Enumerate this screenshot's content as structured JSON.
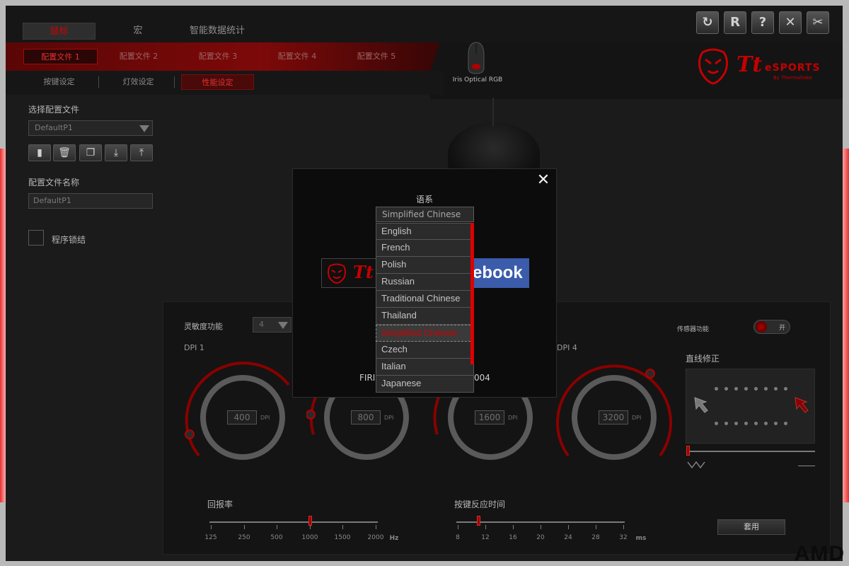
{
  "main_tabs": [
    "鼠标",
    "宏",
    "智能数据统计"
  ],
  "profile_tabs": [
    "配置文件 1",
    "配置文件 2",
    "配置文件 3",
    "配置文件 4",
    "配置文件 5"
  ],
  "sub_tabs": [
    "按键设定",
    "灯效设定",
    "性能设定"
  ],
  "mouse_caption": "Iris Optical RGB",
  "window_buttons": [
    "refresh",
    "reset",
    "help",
    "close",
    "tools"
  ],
  "window_button_glyphs": {
    "refresh": "↻",
    "reset": "R",
    "help": "?",
    "close": "✕",
    "tools": "✂"
  },
  "logo": {
    "tt": "Tt",
    "esports": "eSPORTS",
    "by": "By Thermaltake"
  },
  "left_panel": {
    "select_profile_label": "选择配置文件",
    "select_profile_value": "DefaultP1",
    "profile_name_label": "配置文件名称",
    "profile_name_value": "DefaultP1",
    "lock_label": "程序锁结",
    "icon_buttons": [
      "file-icon",
      "trash-icon",
      "copy-icon",
      "import-icon",
      "export-icon"
    ]
  },
  "performance": {
    "sensitivity_label": "灵敏度功能",
    "sensitivity_value": "4",
    "sensor_label": "传感器功能",
    "sensor_toggle": "开",
    "angle_snapping_label": "直线修正",
    "dpi_labels": [
      "DPI 1",
      "DPI 4"
    ],
    "dpi_values": [
      "400",
      "800",
      "1600",
      "3200"
    ],
    "dpi_unit": "DPI",
    "polling_label": "回报率",
    "polling_ticks": [
      "125",
      "250",
      "500",
      "1000",
      "1500",
      "2000"
    ],
    "polling_unit": "Hz",
    "response_label": "按键反应时间",
    "response_ticks": [
      "8",
      "12",
      "16",
      "20",
      "24",
      "28",
      "32"
    ],
    "response_unit": "ms",
    "apply_label": "套用"
  },
  "modal": {
    "title": "语系",
    "selected": "Simplified Chinese",
    "options": [
      "English",
      "French",
      "Polish",
      "Russian",
      "Traditional Chinese",
      "Thailand",
      "Simplified Chinese",
      "Czech",
      "Italian",
      "Japanese"
    ],
    "banner_tt": "Tt",
    "banner_fb": "ebook",
    "firmware_left": "FIRI",
    "firmware_right": "004"
  },
  "watermark": "AMD",
  "colors": {
    "accent": "#d00000",
    "background": "#1b1b1b",
    "facebook": "#3b5bab"
  }
}
